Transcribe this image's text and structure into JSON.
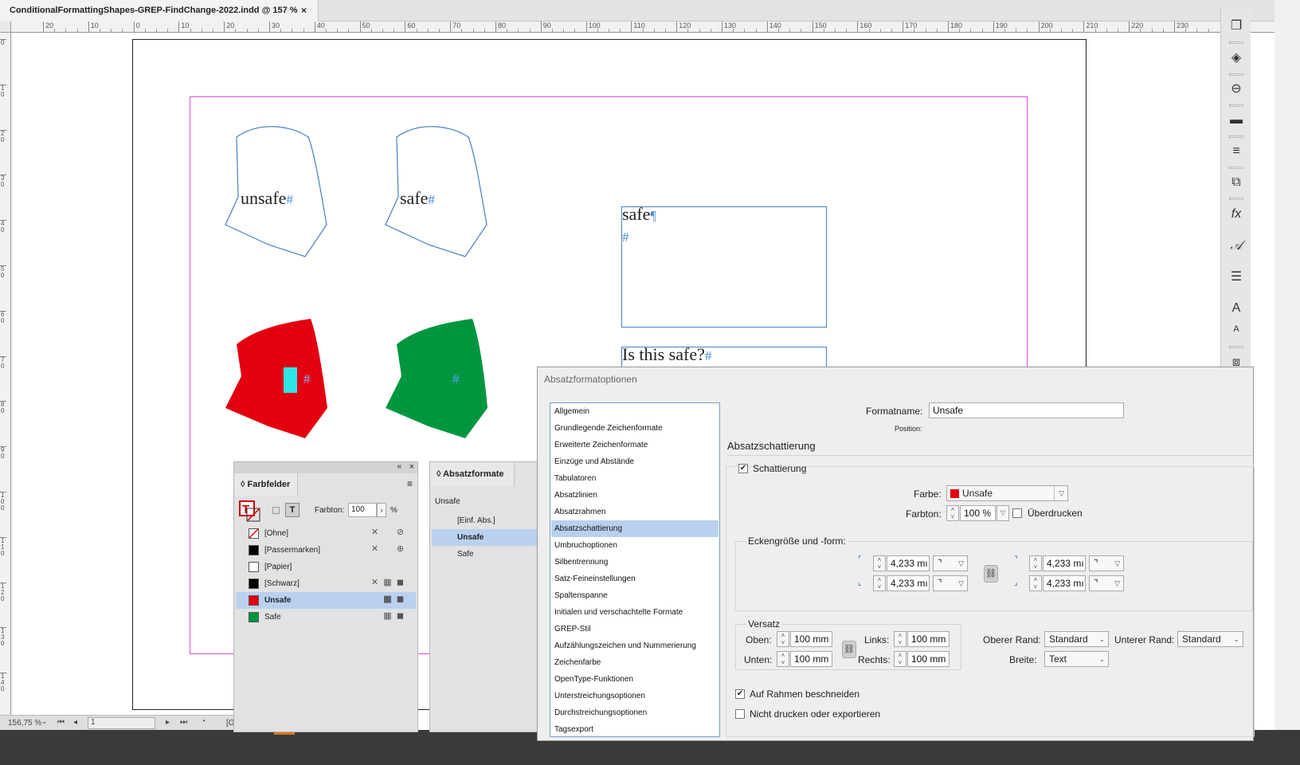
{
  "document": {
    "tab_title": "ConditionalFormattingShapes-GREP-FindChange-2022.indd @ 157 %",
    "close_glyph": "×"
  },
  "rulers": {
    "h_labels": [
      "20",
      "10",
      "0",
      "10",
      "20",
      "30",
      "40",
      "50",
      "60",
      "70",
      "80",
      "90",
      "100",
      "110",
      "120",
      "130",
      "140",
      "150",
      "160",
      "170",
      "180",
      "190",
      "200",
      "210",
      "220",
      "230"
    ],
    "v_labels": [
      "0",
      "1 0",
      "2 0",
      "3 0",
      "4 0",
      "5 0",
      "6 0",
      "7 0",
      "8 0",
      "9 0",
      "1 0 0",
      "1 1 0",
      "1 2 0",
      "1 3 0",
      "1 4 0"
    ]
  },
  "canvas": {
    "shape1_text": "unsafe",
    "shape2_text": "safe",
    "hash": "#",
    "pilcrow": "¶",
    "frame1_text": "safe",
    "frame2_text": "Is this safe?",
    "colors": {
      "unsafe_red": "#e3000f",
      "safe_green": "#009640",
      "cyan_cursor": "#2de6e6",
      "margin": "#d34fd3",
      "frame_blue": "#4a7ec0"
    }
  },
  "statusbar": {
    "zoom": "156,75 %",
    "page": "1",
    "extra": "[G"
  },
  "swatches_panel": {
    "title": "Farbfelder",
    "tint_label": "Farbton:",
    "tint_value": "100",
    "tint_unit": "%",
    "items": [
      {
        "name": "[Ohne]",
        "color": "none"
      },
      {
        "name": "[Passermarken]",
        "color": "#000000"
      },
      {
        "name": "[Papier]",
        "color": "#ffffff"
      },
      {
        "name": "[Schwarz]",
        "color": "#000000"
      },
      {
        "name": "Unsafe",
        "color": "#e3000f"
      },
      {
        "name": "Safe",
        "color": "#009640"
      }
    ]
  },
  "para_styles_panel": {
    "title": "Absatzformate",
    "current": "Unsafe",
    "items": [
      "[Einf. Abs.]",
      "Unsafe",
      "Safe"
    ]
  },
  "dialog": {
    "title": "Absatzformatoptionen",
    "list": [
      "Allgemein",
      "Grundlegende Zeichenformate",
      "Erweiterte Zeichenformate",
      "Einzüge und Abstände",
      "Tabulatoren",
      "Absatzlinien",
      "Absatzrahmen",
      "Absatzschattierung",
      "Umbruchoptionen",
      "Silbentrennung",
      "Satz-Feineinstellungen",
      "Spaltenspanne",
      "Initialen und verschachtelte Formate",
      "GREP-Stil",
      "Aufzählungszeichen und Nummerierung",
      "Zeichenfarbe",
      "OpenType-Funktionen",
      "Unterstreichungsoptionen",
      "Durchstreichungsoptionen",
      "Tagsexport"
    ],
    "selected_index": 7,
    "formatname_label": "Formatname:",
    "formatname_value": "Unsafe",
    "position_label": "Position:",
    "section_title": "Absatzschattierung",
    "shading_label": "Schattierung",
    "farbe_label": "Farbe:",
    "farbe_value": "Unsafe",
    "farbe_color": "#e3000f",
    "farbton_label": "Farbton:",
    "farbton_value": "100 %",
    "overprint_label": "Überdrucken",
    "corner_title": "Eckengröße und -form:",
    "corner_tl": "4,233 mı",
    "corner_bl": "4,233 mı",
    "corner_tr": "4,233 mı",
    "corner_br": "4,233 mı",
    "offset_title": "Versatz",
    "oben_label": "Oben:",
    "oben_value": "100 mm",
    "unten_label": "Unten:",
    "unten_value": "100 mm",
    "links_label": "Links:",
    "links_value": "100 mm",
    "rechts_label": "Rechts:",
    "rechts_value": "100 mm",
    "oberer_rand_label": "Oberer Rand:",
    "oberer_rand_value": "Standard",
    "unterer_rand_label": "Unterer Rand:",
    "unterer_rand_value": "Standard",
    "breite_label": "Breite:",
    "breite_value": "Text",
    "clip_label": "Auf Rahmen beschneiden",
    "noprint_label": "Nicht drucken oder exportieren"
  }
}
